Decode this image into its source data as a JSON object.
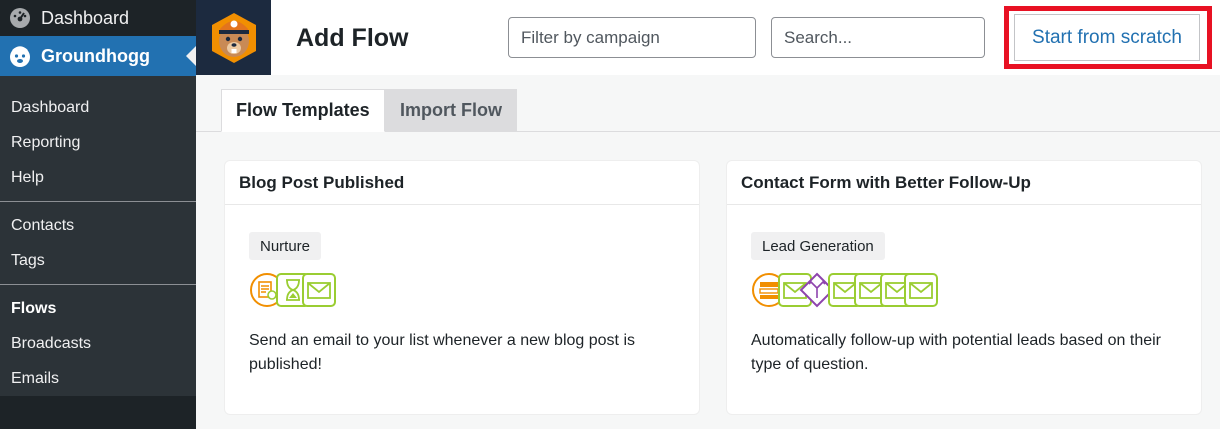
{
  "sidebar": {
    "top_items": [
      {
        "label": "Dashboard",
        "icon": "dashboard-gauge-icon"
      },
      {
        "label": "Groundhogg",
        "icon": "groundhogg-logo-icon"
      }
    ],
    "sub_items": [
      {
        "label": "Dashboard"
      },
      {
        "label": "Reporting"
      },
      {
        "label": "Help"
      },
      {
        "label": "Contacts"
      },
      {
        "label": "Tags"
      },
      {
        "label": "Flows"
      },
      {
        "label": "Broadcasts"
      },
      {
        "label": "Emails"
      }
    ]
  },
  "header": {
    "title": "Add Flow",
    "campaign_placeholder": "Filter by campaign",
    "search_placeholder": "Search...",
    "start_button": "Start from scratch"
  },
  "tabs": [
    {
      "label": "Flow Templates",
      "active": true
    },
    {
      "label": "Import Flow",
      "active": false
    }
  ],
  "cards": [
    {
      "title": "Blog Post Published",
      "tag": "Nurture",
      "description": "Send an email to your list whenever a new blog post is published!",
      "steps": [
        "blog-post-trigger-icon",
        "delay-timer-icon",
        "send-email-icon"
      ]
    },
    {
      "title": "Contact Form with Better Follow-Up",
      "tag": "Lead Generation",
      "description": "Automatically follow-up with potential leads based on their type of question.",
      "steps": [
        "form-trigger-icon",
        "send-email-icon",
        "split-path-icon",
        "send-email-icon",
        "send-email-icon",
        "send-email-icon",
        "send-email-icon"
      ]
    }
  ],
  "colors": {
    "sidebar_bg": "#1d2327",
    "accent": "#2271b1",
    "highlight": "#e81123",
    "benchmark": "#f18f01",
    "action": "#9acd32",
    "logic": "#8e44ad"
  }
}
